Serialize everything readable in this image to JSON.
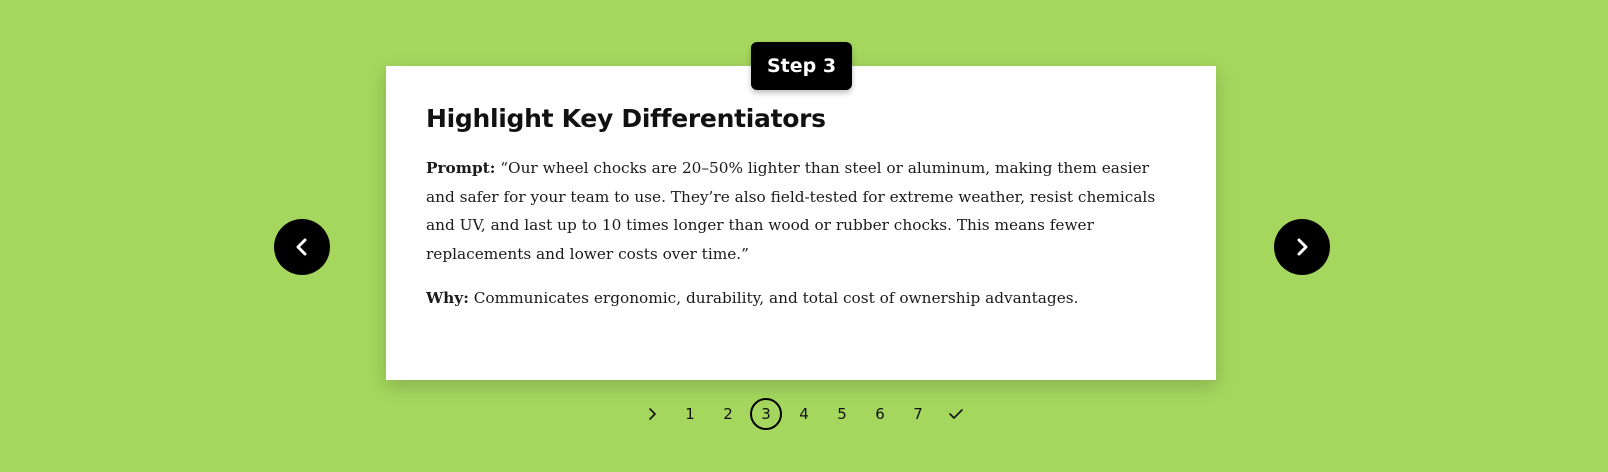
{
  "card": {
    "step_badge": "Step 3",
    "title": "Highlight Key Differentiators",
    "prompt_label": "Prompt:",
    "prompt_text": " “Our wheel chocks are 20–50% lighter than steel or aluminum, making them easier and safer for your team to use. They’re also field-tested for extreme weather, resist chemicals and UV, and last up to 10 times longer than wood or rubber chocks. This means fewer replacements and lower costs over time.”",
    "why_label": "Why:",
    "why_text": " Communicates ergonomic, durability, and total cost of ownership advantages."
  },
  "navigation": {
    "prev_icon": "chevron-left-icon",
    "next_icon": "chevron-right-icon"
  },
  "pager": {
    "start_icon": "chevron-right-icon",
    "pages": [
      "1",
      "2",
      "3",
      "4",
      "5",
      "6",
      "7"
    ],
    "active_page": "3",
    "end_icon": "checkmark-icon"
  },
  "colors": {
    "background": "#a5d75e",
    "card": "#ffffff",
    "accent": "#000000"
  }
}
